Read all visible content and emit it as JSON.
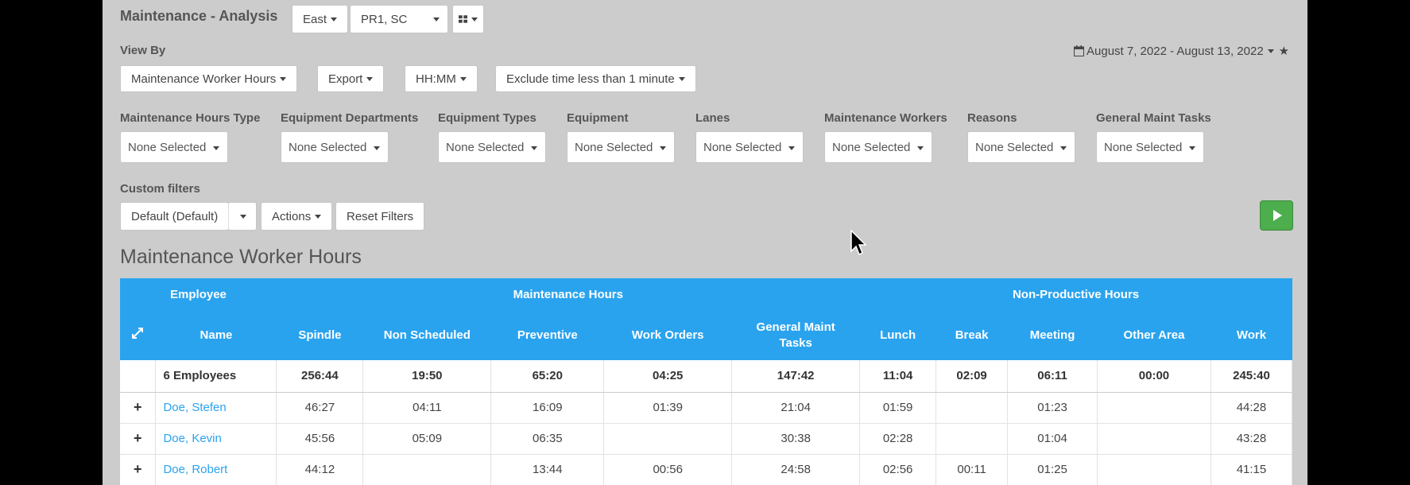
{
  "header": {
    "title": "Maintenance - Analysis",
    "region": "East",
    "location": "PR1, SC",
    "view_by_label": "View By",
    "date_range": "August 7, 2022 - August 13, 2022"
  },
  "view_controls": {
    "report": "Maintenance Worker Hours",
    "export": "Export",
    "time_format": "HH:MM",
    "exclude": "Exclude time less than 1 minute"
  },
  "filters": [
    {
      "label": "Maintenance Hours Type",
      "value": "None Selected"
    },
    {
      "label": "Equipment Departments",
      "value": "None Selected"
    },
    {
      "label": "Equipment Types",
      "value": "None Selected"
    },
    {
      "label": "Equipment",
      "value": "None Selected"
    },
    {
      "label": "Lanes",
      "value": "None Selected"
    },
    {
      "label": "Maintenance Workers",
      "value": "None Selected"
    },
    {
      "label": "Reasons",
      "value": "None Selected"
    },
    {
      "label": "General Maint Tasks",
      "value": "None Selected"
    }
  ],
  "custom_filters": {
    "label": "Custom filters",
    "default": "Default (Default)",
    "actions": "Actions",
    "reset": "Reset Filters"
  },
  "section_title": "Maintenance Worker Hours",
  "table": {
    "groups": {
      "employee": "Employee",
      "maintenance": "Maintenance Hours",
      "nonproductive": "Non-Productive Hours"
    },
    "columns": [
      "Name",
      "Spindle",
      "Non Scheduled",
      "Preventive",
      "Work Orders",
      "General Maint Tasks",
      "Lunch",
      "Break",
      "Meeting",
      "Other Area",
      "Work"
    ],
    "totals": {
      "name": "6 Employees",
      "spindle": "256:44",
      "non_scheduled": "19:50",
      "preventive": "65:20",
      "work_orders": "04:25",
      "general": "147:42",
      "lunch": "11:04",
      "break": "02:09",
      "meeting": "06:11",
      "other_area": "00:00",
      "work": "245:40"
    },
    "rows": [
      {
        "name": "Doe, Stefen",
        "spindle": "46:27",
        "non_scheduled": "04:11",
        "preventive": "16:09",
        "work_orders": "01:39",
        "general": "21:04",
        "lunch": "01:59",
        "break": "",
        "meeting": "01:23",
        "other_area": "",
        "work": "44:28"
      },
      {
        "name": "Doe, Kevin",
        "spindle": "45:56",
        "non_scheduled": "05:09",
        "preventive": "06:35",
        "work_orders": "",
        "general": "30:38",
        "lunch": "02:28",
        "break": "",
        "meeting": "01:04",
        "other_area": "",
        "work": "43:28"
      },
      {
        "name": "Doe, Robert",
        "spindle": "44:12",
        "non_scheduled": "",
        "preventive": "13:44",
        "work_orders": "00:56",
        "general": "24:58",
        "lunch": "02:56",
        "break": "00:11",
        "meeting": "01:25",
        "other_area": "",
        "work": "41:15"
      }
    ]
  }
}
